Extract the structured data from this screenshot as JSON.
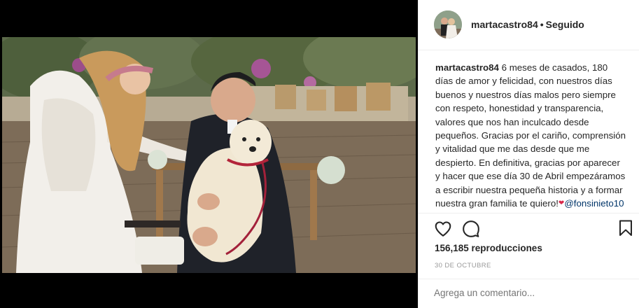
{
  "post": {
    "username": "martacastro84",
    "separator": "•",
    "follow_status": "Seguido",
    "caption_text": "6 meses de casados, 180 días de amor y felicidad, con nuestros días buenos y nuestros días malos pero siempre con respeto, honestidad y transparencia, valores que nos han inculcado desde pequeños. Gracias por el cariño, comprensión y vitalidad que me das desde que me despierto. En definitiva, gracias por aparecer y hacer que ese día 30 de Abril empezáramos a escribir nuestra pequeña historia y a formar nuestra gran familia te quiero!",
    "caption_mention": "@fonsinieto10",
    "views": "156,185 reproducciones",
    "date": "30 DE OCTUBRE",
    "comment_placeholder": "Agrega un comentario..."
  },
  "icons": {
    "like": "heart-outline-icon",
    "comment": "speech-bubble-icon",
    "save": "bookmark-icon",
    "caption_emoji": "red-heart-icon"
  },
  "colors": {
    "text": "#262626",
    "muted": "#999999",
    "mention": "#003569",
    "border": "#efefef",
    "heart": "#d8284a"
  }
}
